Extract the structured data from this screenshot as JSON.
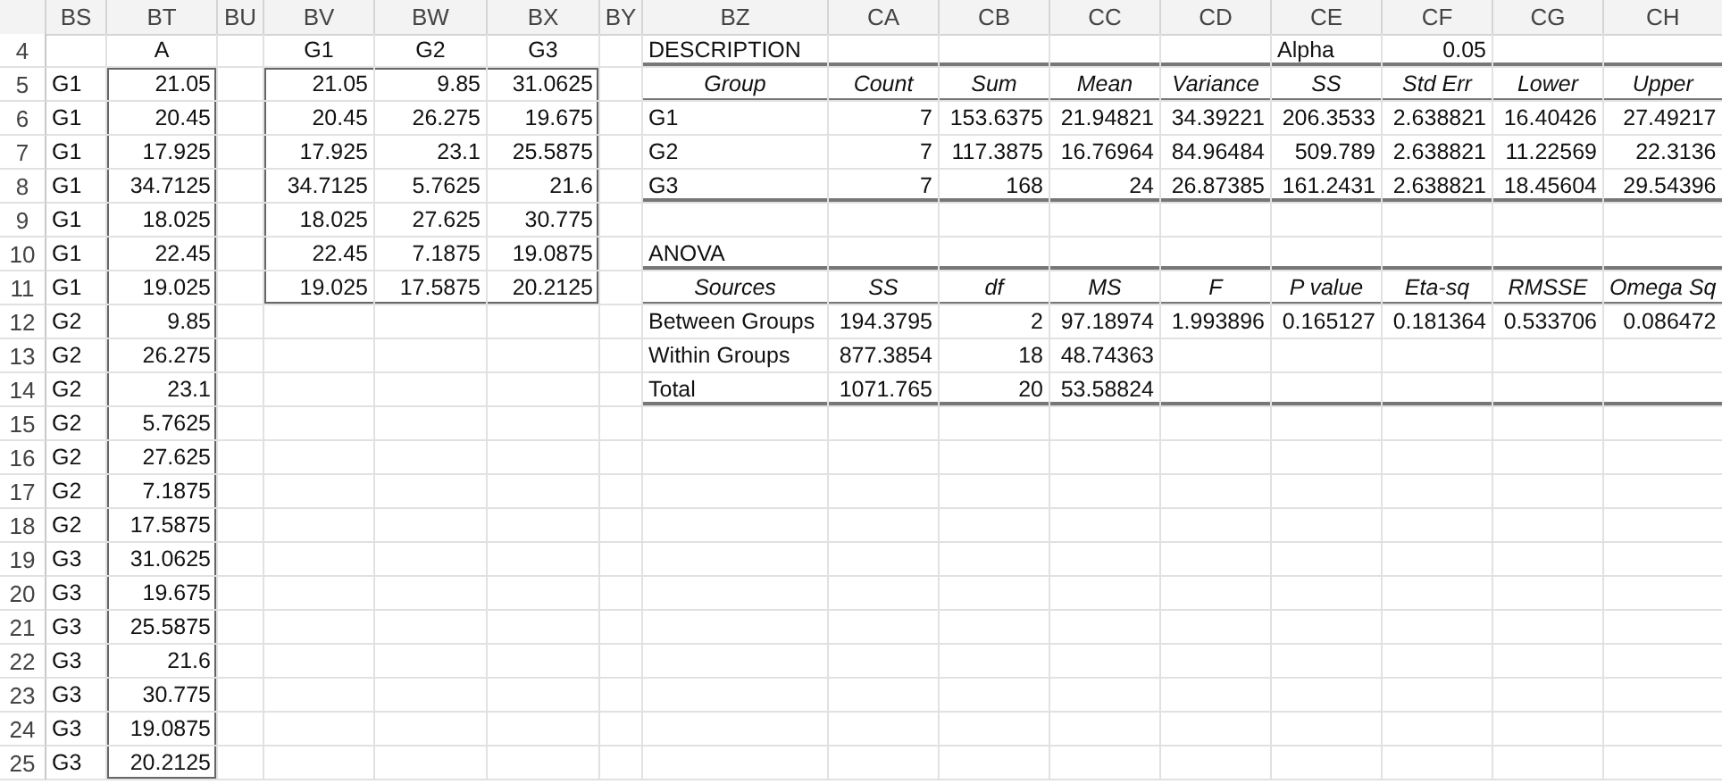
{
  "columns": [
    "BS",
    "BT",
    "BU",
    "BV",
    "BW",
    "BX",
    "BY",
    "BZ",
    "CA",
    "CB",
    "CC",
    "CD",
    "CE",
    "CF",
    "CG",
    "CH"
  ],
  "rows": [
    {
      "number": "4",
      "cells": {
        "BT": {
          "text": "A",
          "kind": "title"
        },
        "BV": {
          "text": "G1",
          "kind": "title"
        },
        "BW": {
          "text": "G2",
          "kind": "title"
        },
        "BX": {
          "text": "G3",
          "kind": "title"
        },
        "BZ": {
          "text": "DESCRIPTION",
          "kind": "label"
        },
        "CE": {
          "text": "Alpha",
          "kind": "label"
        },
        "CF": {
          "text": "0.05",
          "kind": "number"
        }
      }
    },
    {
      "number": "5",
      "cells": {
        "BS": {
          "text": "G1",
          "kind": "label"
        },
        "BT": {
          "text": "21.05",
          "kind": "number"
        },
        "BV": {
          "text": "21.05",
          "kind": "number"
        },
        "BW": {
          "text": "9.85",
          "kind": "number"
        },
        "BX": {
          "text": "31.0625",
          "kind": "number"
        },
        "BZ": {
          "text": "Group",
          "kind": "header"
        },
        "CA": {
          "text": "Count",
          "kind": "header"
        },
        "CB": {
          "text": "Sum",
          "kind": "header"
        },
        "CC": {
          "text": "Mean",
          "kind": "header"
        },
        "CD": {
          "text": "Variance",
          "kind": "header"
        },
        "CE": {
          "text": "SS",
          "kind": "header"
        },
        "CF": {
          "text": "Std Err",
          "kind": "header"
        },
        "CG": {
          "text": "Lower",
          "kind": "header"
        },
        "CH": {
          "text": "Upper",
          "kind": "header"
        }
      }
    },
    {
      "number": "6",
      "cells": {
        "BS": {
          "text": "G1",
          "kind": "label"
        },
        "BT": {
          "text": "20.45",
          "kind": "number"
        },
        "BV": {
          "text": "20.45",
          "kind": "number"
        },
        "BW": {
          "text": "26.275",
          "kind": "number"
        },
        "BX": {
          "text": "19.675",
          "kind": "number"
        },
        "BZ": {
          "text": "G1",
          "kind": "label"
        },
        "CA": {
          "text": "7",
          "kind": "number"
        },
        "CB": {
          "text": "153.6375",
          "kind": "number"
        },
        "CC": {
          "text": "21.94821",
          "kind": "number"
        },
        "CD": {
          "text": "34.39221",
          "kind": "number"
        },
        "CE": {
          "text": "206.3533",
          "kind": "number"
        },
        "CF": {
          "text": "2.638821",
          "kind": "number"
        },
        "CG": {
          "text": "16.40426",
          "kind": "number"
        },
        "CH": {
          "text": "27.49217",
          "kind": "number"
        }
      }
    },
    {
      "number": "7",
      "cells": {
        "BS": {
          "text": "G1",
          "kind": "label"
        },
        "BT": {
          "text": "17.925",
          "kind": "number"
        },
        "BV": {
          "text": "17.925",
          "kind": "number"
        },
        "BW": {
          "text": "23.1",
          "kind": "number"
        },
        "BX": {
          "text": "25.5875",
          "kind": "number"
        },
        "BZ": {
          "text": "G2",
          "kind": "label"
        },
        "CA": {
          "text": "7",
          "kind": "number"
        },
        "CB": {
          "text": "117.3875",
          "kind": "number"
        },
        "CC": {
          "text": "16.76964",
          "kind": "number"
        },
        "CD": {
          "text": "84.96484",
          "kind": "number"
        },
        "CE": {
          "text": "509.789",
          "kind": "number"
        },
        "CF": {
          "text": "2.638821",
          "kind": "number"
        },
        "CG": {
          "text": "11.22569",
          "kind": "number"
        },
        "CH": {
          "text": "22.3136",
          "kind": "number"
        }
      }
    },
    {
      "number": "8",
      "cells": {
        "BS": {
          "text": "G1",
          "kind": "label"
        },
        "BT": {
          "text": "34.7125",
          "kind": "number"
        },
        "BV": {
          "text": "34.7125",
          "kind": "number"
        },
        "BW": {
          "text": "5.7625",
          "kind": "number"
        },
        "BX": {
          "text": "21.6",
          "kind": "number"
        },
        "BZ": {
          "text": "G3",
          "kind": "label"
        },
        "CA": {
          "text": "7",
          "kind": "number"
        },
        "CB": {
          "text": "168",
          "kind": "number"
        },
        "CC": {
          "text": "24",
          "kind": "number"
        },
        "CD": {
          "text": "26.87385",
          "kind": "number"
        },
        "CE": {
          "text": "161.2431",
          "kind": "number"
        },
        "CF": {
          "text": "2.638821",
          "kind": "number"
        },
        "CG": {
          "text": "18.45604",
          "kind": "number"
        },
        "CH": {
          "text": "29.54396",
          "kind": "number"
        }
      }
    },
    {
      "number": "9",
      "cells": {
        "BS": {
          "text": "G1",
          "kind": "label"
        },
        "BT": {
          "text": "18.025",
          "kind": "number"
        },
        "BV": {
          "text": "18.025",
          "kind": "number"
        },
        "BW": {
          "text": "27.625",
          "kind": "number"
        },
        "BX": {
          "text": "30.775",
          "kind": "number"
        }
      }
    },
    {
      "number": "10",
      "cells": {
        "BS": {
          "text": "G1",
          "kind": "label"
        },
        "BT": {
          "text": "22.45",
          "kind": "number"
        },
        "BV": {
          "text": "22.45",
          "kind": "number"
        },
        "BW": {
          "text": "7.1875",
          "kind": "number"
        },
        "BX": {
          "text": "19.0875",
          "kind": "number"
        },
        "BZ": {
          "text": "ANOVA",
          "kind": "label"
        }
      }
    },
    {
      "number": "11",
      "cells": {
        "BS": {
          "text": "G1",
          "kind": "label"
        },
        "BT": {
          "text": "19.025",
          "kind": "number"
        },
        "BV": {
          "text": "19.025",
          "kind": "number"
        },
        "BW": {
          "text": "17.5875",
          "kind": "number"
        },
        "BX": {
          "text": "20.2125",
          "kind": "number"
        },
        "BZ": {
          "text": "Sources",
          "kind": "header"
        },
        "CA": {
          "text": "SS",
          "kind": "header"
        },
        "CB": {
          "text": "df",
          "kind": "header"
        },
        "CC": {
          "text": "MS",
          "kind": "header"
        },
        "CD": {
          "text": "F",
          "kind": "header"
        },
        "CE": {
          "text": "P value",
          "kind": "header"
        },
        "CF": {
          "text": "Eta-sq",
          "kind": "header"
        },
        "CG": {
          "text": "RMSSE",
          "kind": "header"
        },
        "CH": {
          "text": "Omega Sq",
          "kind": "header"
        }
      }
    },
    {
      "number": "12",
      "cells": {
        "BS": {
          "text": "G2",
          "kind": "label"
        },
        "BT": {
          "text": "9.85",
          "kind": "number"
        },
        "BZ": {
          "text": "Between Groups",
          "kind": "label"
        },
        "CA": {
          "text": "194.3795",
          "kind": "number"
        },
        "CB": {
          "text": "2",
          "kind": "number"
        },
        "CC": {
          "text": "97.18974",
          "kind": "number"
        },
        "CD": {
          "text": "1.993896",
          "kind": "number"
        },
        "CE": {
          "text": "0.165127",
          "kind": "number"
        },
        "CF": {
          "text": "0.181364",
          "kind": "number"
        },
        "CG": {
          "text": "0.533706",
          "kind": "number"
        },
        "CH": {
          "text": "0.086472",
          "kind": "number"
        }
      }
    },
    {
      "number": "13",
      "cells": {
        "BS": {
          "text": "G2",
          "kind": "label"
        },
        "BT": {
          "text": "26.275",
          "kind": "number"
        },
        "BZ": {
          "text": "Within Groups",
          "kind": "label"
        },
        "CA": {
          "text": "877.3854",
          "kind": "number"
        },
        "CB": {
          "text": "18",
          "kind": "number"
        },
        "CC": {
          "text": "48.74363",
          "kind": "number"
        }
      }
    },
    {
      "number": "14",
      "cells": {
        "BS": {
          "text": "G2",
          "kind": "label"
        },
        "BT": {
          "text": "23.1",
          "kind": "number"
        },
        "BZ": {
          "text": "Total",
          "kind": "label"
        },
        "CA": {
          "text": "1071.765",
          "kind": "number"
        },
        "CB": {
          "text": "20",
          "kind": "number"
        },
        "CC": {
          "text": "53.58824",
          "kind": "number"
        }
      }
    },
    {
      "number": "15",
      "cells": {
        "BS": {
          "text": "G2",
          "kind": "label"
        },
        "BT": {
          "text": "5.7625",
          "kind": "number"
        }
      }
    },
    {
      "number": "16",
      "cells": {
        "BS": {
          "text": "G2",
          "kind": "label"
        },
        "BT": {
          "text": "27.625",
          "kind": "number"
        }
      }
    },
    {
      "number": "17",
      "cells": {
        "BS": {
          "text": "G2",
          "kind": "label"
        },
        "BT": {
          "text": "7.1875",
          "kind": "number"
        }
      }
    },
    {
      "number": "18",
      "cells": {
        "BS": {
          "text": "G2",
          "kind": "label"
        },
        "BT": {
          "text": "17.5875",
          "kind": "number"
        }
      }
    },
    {
      "number": "19",
      "cells": {
        "BS": {
          "text": "G3",
          "kind": "label"
        },
        "BT": {
          "text": "31.0625",
          "kind": "number"
        }
      }
    },
    {
      "number": "20",
      "cells": {
        "BS": {
          "text": "G3",
          "kind": "label"
        },
        "BT": {
          "text": "19.675",
          "kind": "number"
        }
      }
    },
    {
      "number": "21",
      "cells": {
        "BS": {
          "text": "G3",
          "kind": "label"
        },
        "BT": {
          "text": "25.5875",
          "kind": "number"
        }
      }
    },
    {
      "number": "22",
      "cells": {
        "BS": {
          "text": "G3",
          "kind": "label"
        },
        "BT": {
          "text": "21.6",
          "kind": "number"
        }
      }
    },
    {
      "number": "23",
      "cells": {
        "BS": {
          "text": "G3",
          "kind": "label"
        },
        "BT": {
          "text": "30.775",
          "kind": "number"
        }
      }
    },
    {
      "number": "24",
      "cells": {
        "BS": {
          "text": "G3",
          "kind": "label"
        },
        "BT": {
          "text": "19.0875",
          "kind": "number"
        }
      }
    },
    {
      "number": "25",
      "cells": {
        "BS": {
          "text": "G3",
          "kind": "label"
        },
        "BT": {
          "text": "20.2125",
          "kind": "number"
        }
      }
    }
  ]
}
